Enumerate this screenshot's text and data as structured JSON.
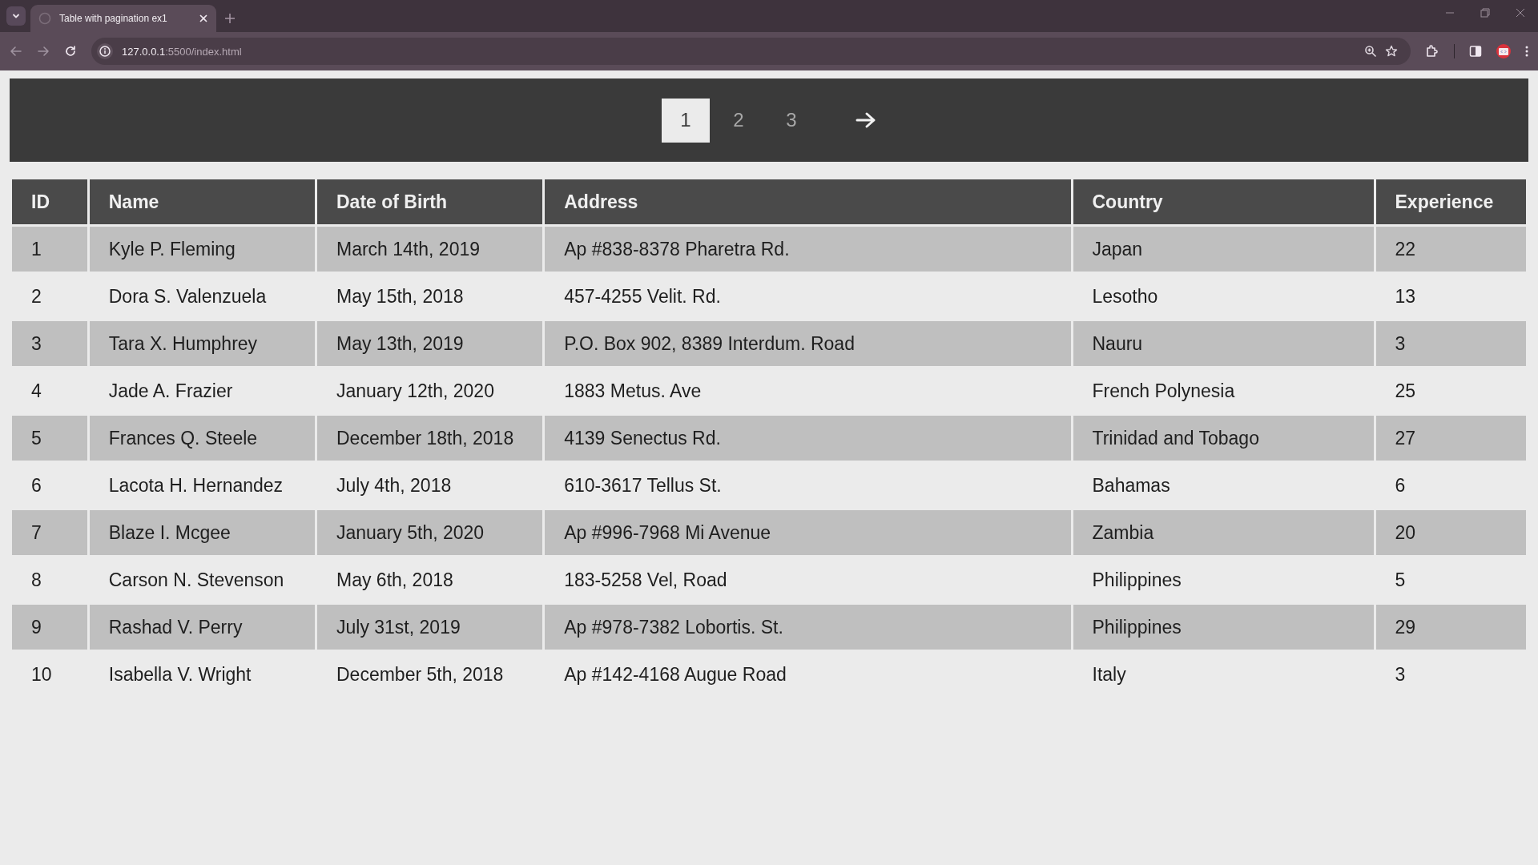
{
  "browser": {
    "tab_title": "Table with pagination ex1",
    "url_host": "127.0.0.1",
    "url_path": ":5500/index.html"
  },
  "pagination": {
    "pages": [
      {
        "label": "1",
        "selected": true
      },
      {
        "label": "2",
        "selected": false
      },
      {
        "label": "3",
        "selected": false
      }
    ]
  },
  "table": {
    "columns": [
      "ID",
      "Name",
      "Date of Birth",
      "Address",
      "Country",
      "Experience"
    ],
    "rows": [
      [
        "1",
        "Kyle P. Fleming",
        "March 14th, 2019",
        "Ap #838-8378 Pharetra Rd.",
        "Japan",
        "22"
      ],
      [
        "2",
        "Dora S. Valenzuela",
        "May 15th, 2018",
        "457-4255 Velit. Rd.",
        "Lesotho",
        "13"
      ],
      [
        "3",
        "Tara X. Humphrey",
        "May 13th, 2019",
        "P.O. Box 902, 8389 Interdum. Road",
        "Nauru",
        "3"
      ],
      [
        "4",
        "Jade A. Frazier",
        "January 12th, 2020",
        "1883 Metus. Ave",
        "French Polynesia",
        "25"
      ],
      [
        "5",
        "Frances Q. Steele",
        "December 18th, 2018",
        "4139 Senectus Rd.",
        "Trinidad and Tobago",
        "27"
      ],
      [
        "6",
        "Lacota H. Hernandez",
        "July 4th, 2018",
        "610-3617 Tellus St.",
        "Bahamas",
        "6"
      ],
      [
        "7",
        "Blaze I. Mcgee",
        "January 5th, 2020",
        "Ap #996-7968 Mi Avenue",
        "Zambia",
        "20"
      ],
      [
        "8",
        "Carson N. Stevenson",
        "May 6th, 2018",
        "183-5258 Vel, Road",
        "Philippines",
        "5"
      ],
      [
        "9",
        "Rashad V. Perry",
        "July 31st, 2019",
        "Ap #978-7382 Lobortis. St.",
        "Philippines",
        "29"
      ],
      [
        "10",
        "Isabella V. Wright",
        "December 5th, 2018",
        "Ap #142-4168 Augue Road",
        "Italy",
        "3"
      ]
    ]
  }
}
